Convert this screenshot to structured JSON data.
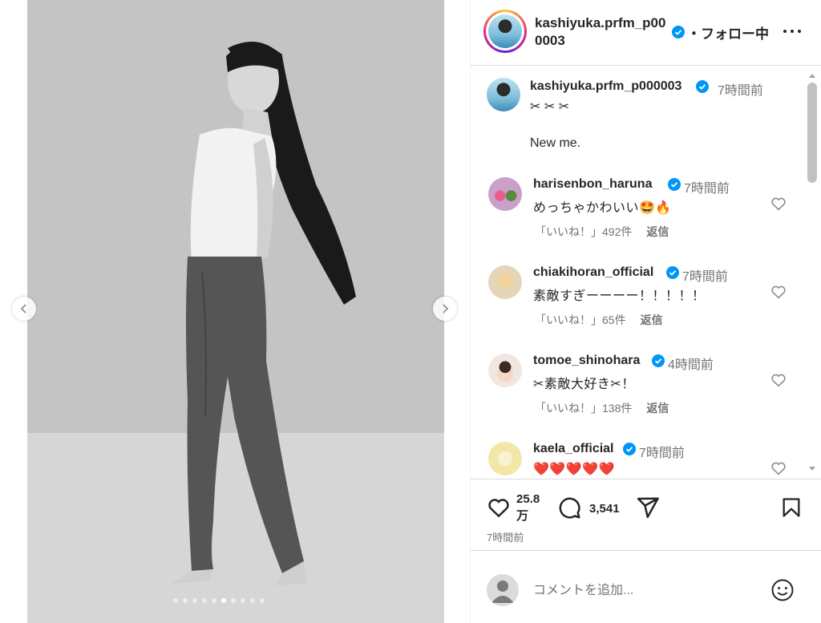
{
  "media": {
    "carousel_total": 10,
    "carousel_active_index": 5
  },
  "post": {
    "author": "kashiyuka.prfm_p000003",
    "follow_status": "・フォロー中",
    "caption_scissors": "✂︎ ✂︎ ✂︎",
    "caption_text": "New me.",
    "caption_time": "7時間前",
    "like_count": "25.8 万",
    "comment_count": "3,541",
    "post_time": "7時間前"
  },
  "comments": [
    {
      "username": "harisenbon_haruna",
      "time": "7時間前",
      "text": "めっちゃかわいい🤩🔥",
      "likes": "「いいね！」492件",
      "reply": "返信",
      "avatar_color": "#c9a0c8"
    },
    {
      "username": "chiakihoran_official",
      "time": "7時間前",
      "text": "素敵すぎーーーー！！！！！",
      "likes": "「いいね！」65件",
      "reply": "返信",
      "avatar_color": "#e4d6b8"
    },
    {
      "username": "tomoe_shinohara",
      "time": "4時間前",
      "text": "✂︎素敵大好き✂︎！",
      "likes": "「いいね！」138件",
      "reply": "返信",
      "avatar_color": "#f0e7e0"
    },
    {
      "username": "kaela_official",
      "time": "7時間前",
      "text": "❤️❤️❤️❤️❤️",
      "likes": "",
      "reply": "",
      "avatar_color": "#f3e7a8"
    }
  ],
  "add_comment": {
    "placeholder": "コメントを追加..."
  },
  "icons": {
    "verified": "verified-badge-icon",
    "like": "heart-icon",
    "comment": "comment-bubble-icon",
    "share": "share-paper-plane-icon",
    "save": "bookmark-icon",
    "emoji": "emoji-smile-icon",
    "more": "more-options-icon"
  },
  "colors": {
    "verified": "#0095f6",
    "text": "#262626",
    "muted": "#737373",
    "divider": "#dbdbdb"
  }
}
